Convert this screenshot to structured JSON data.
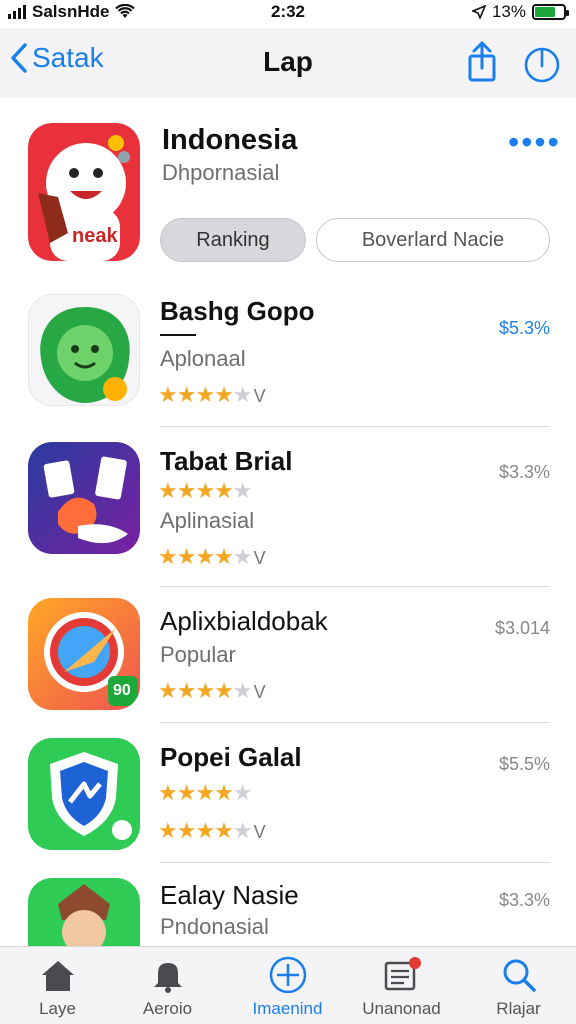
{
  "status_bar": {
    "carrier": "SalsnHde",
    "time": "2:32",
    "battery": "13%",
    "icons": [
      "signal-icon",
      "wifi-icon",
      "location-icon",
      "battery-icon"
    ]
  },
  "nav": {
    "back_label": "Satak",
    "title": "Lap",
    "icons": [
      "chevron-left-icon",
      "share-icon",
      "power-icon"
    ]
  },
  "header_app": {
    "title": "Indonesia",
    "subtitle": "Dhpornasial",
    "icon_text": "neak",
    "more_label": "••••",
    "segments": [
      {
        "label": "Ranking",
        "selected": true
      },
      {
        "label": "Boverlard Nacie",
        "selected": false
      }
    ]
  },
  "apps": [
    {
      "title": "Bashg Gopo",
      "subtitle": "Aplonaal",
      "price": "$5.3%",
      "rating": 4,
      "rating_suffix": "V",
      "icon": "green-monster-icon"
    },
    {
      "title": "Tabat Brial",
      "subtitle": "Aplinasial",
      "price": "$3.3%",
      "rating": 4,
      "second_rating": 4,
      "rating_suffix": "V",
      "icon": "photo-bird-icon"
    },
    {
      "title": "Aplixbialdobak",
      "subtitle": "Popular",
      "price": "$3.014",
      "rating": 4,
      "rating_suffix": "V",
      "badge": "90",
      "icon": "compass-icon"
    },
    {
      "title": "Popei Galal",
      "price": "$5.5%",
      "rating": 4,
      "second_rating": 4,
      "rating_suffix": "V",
      "icon": "shield-icon"
    },
    {
      "title": "Ealay Nasie",
      "subtitle": "Pndonasial",
      "price": "$3.3%",
      "icon": "character-icon"
    }
  ],
  "tabs": [
    {
      "label": "Laye",
      "icon": "home-icon"
    },
    {
      "label": "Aeroio",
      "icon": "bell-icon"
    },
    {
      "label": "Imaenind",
      "icon": "add-circle-icon"
    },
    {
      "label": "Unanonad",
      "icon": "news-icon"
    },
    {
      "label": "Rlajar",
      "icon": "search-icon"
    }
  ],
  "colors": {
    "accent": "#1a7ef0",
    "star": "#f5a623",
    "battery": "#1fa83a"
  }
}
